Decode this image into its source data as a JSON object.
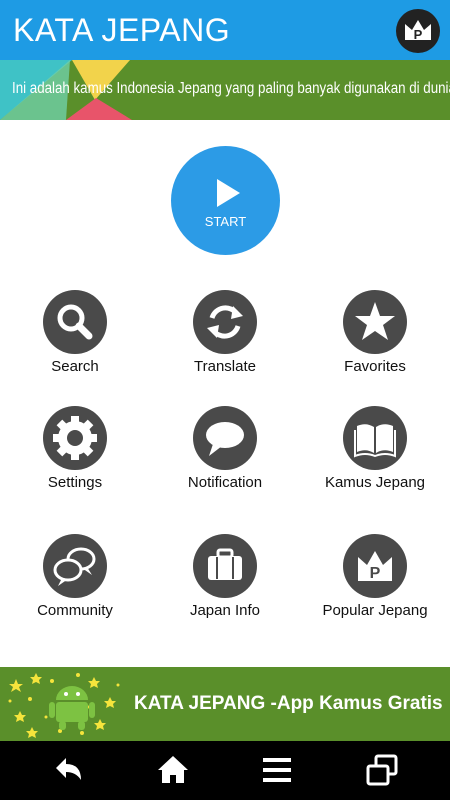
{
  "header": {
    "title": "KATA JEPANG",
    "crown_icon": "crown-p-icon"
  },
  "banner": {
    "text": "Ini adalah kamus Indonesia Jepang yang paling banyak digunakan di dunia."
  },
  "start": {
    "label": "START",
    "icon": "play-icon"
  },
  "menu": [
    {
      "label": "Search",
      "icon": "search-icon"
    },
    {
      "label": "Translate",
      "icon": "refresh-icon"
    },
    {
      "label": "Favorites",
      "icon": "star-icon"
    },
    {
      "label": "Settings",
      "icon": "gear-icon"
    },
    {
      "label": "Notification",
      "icon": "speech-bubble-icon"
    },
    {
      "label": "Kamus Jepang",
      "icon": "book-icon"
    },
    {
      "label": "Community",
      "icon": "chat-bubbles-icon"
    },
    {
      "label": "Japan Info",
      "icon": "briefcase-icon"
    },
    {
      "label": "Popular Jepang",
      "icon": "crown-p-icon"
    }
  ],
  "promo": {
    "text": "KATA JEPANG -App Kamus Gratis",
    "icon": "android-stars-icon"
  },
  "navbar": {
    "buttons": [
      "back-icon",
      "home-icon",
      "menu-icon",
      "recent-apps-icon"
    ]
  },
  "colors": {
    "header": "#1e9be4",
    "banner": "#5a8f2a",
    "start": "#2c9be6",
    "icon_circle": "#4a4a4a",
    "navbar": "#000000"
  }
}
